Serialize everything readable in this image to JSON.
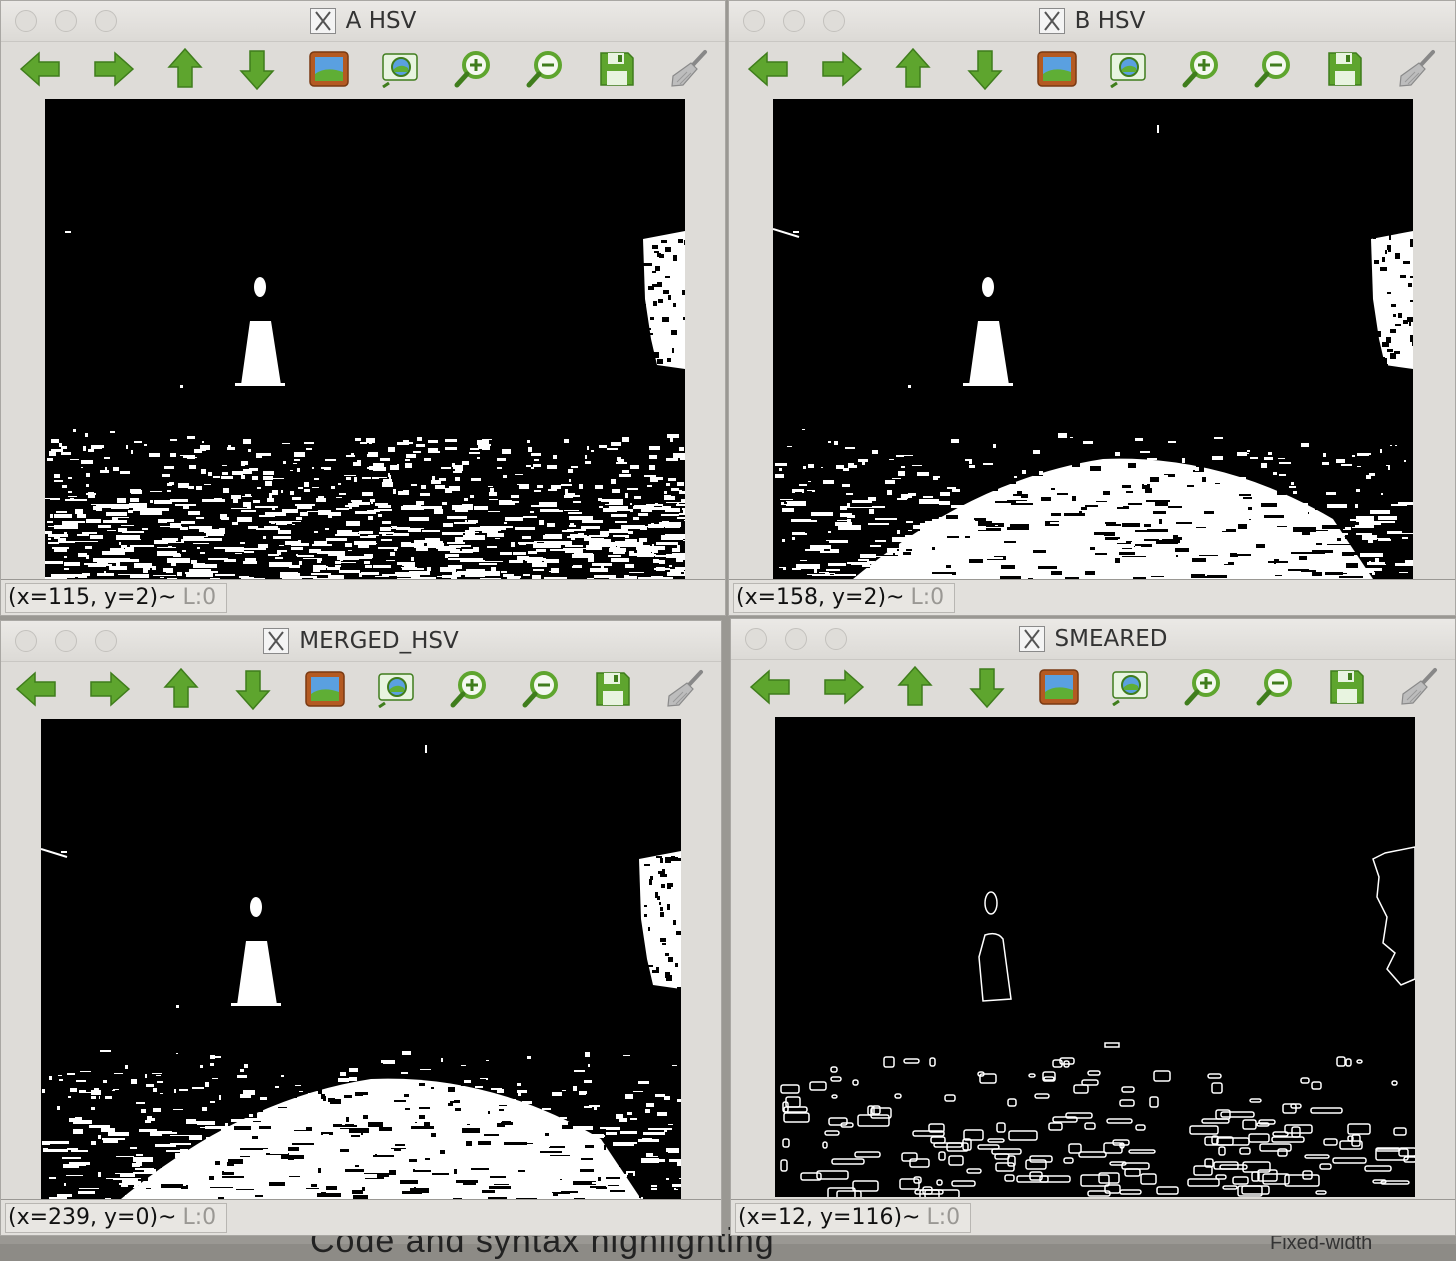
{
  "background": {
    "text_main": "Code and syntax highlighting",
    "text_side": "Fixed-width"
  },
  "toolbar_icons": [
    "arrow-left-icon",
    "arrow-right-icon",
    "arrow-up-icon",
    "arrow-down-icon",
    "image-icon",
    "zoom-fit-icon",
    "zoom-in-icon",
    "zoom-out-icon",
    "save-icon",
    "broom-icon"
  ],
  "windows": [
    {
      "title": "A HSV",
      "status": "(x=115, y=2)",
      "layer_sep": " ~ ",
      "layer": "L:0"
    },
    {
      "title": "B HSV",
      "status": "(x=158, y=2)",
      "layer_sep": " ~ ",
      "layer": "L:0"
    },
    {
      "title": "MERGED_HSV",
      "status": "(x=239, y=0)",
      "layer_sep": " ~ ",
      "layer": "L:0"
    },
    {
      "title": "SMEARED",
      "status": "(x=12, y=116)",
      "layer_sep": " ~ ",
      "layer": "L:0"
    }
  ],
  "colors": {
    "icon_green": "#5ea52e",
    "icon_dark": "#3f7d1c",
    "canvas": "#000000",
    "foreground": "#ffffff"
  }
}
